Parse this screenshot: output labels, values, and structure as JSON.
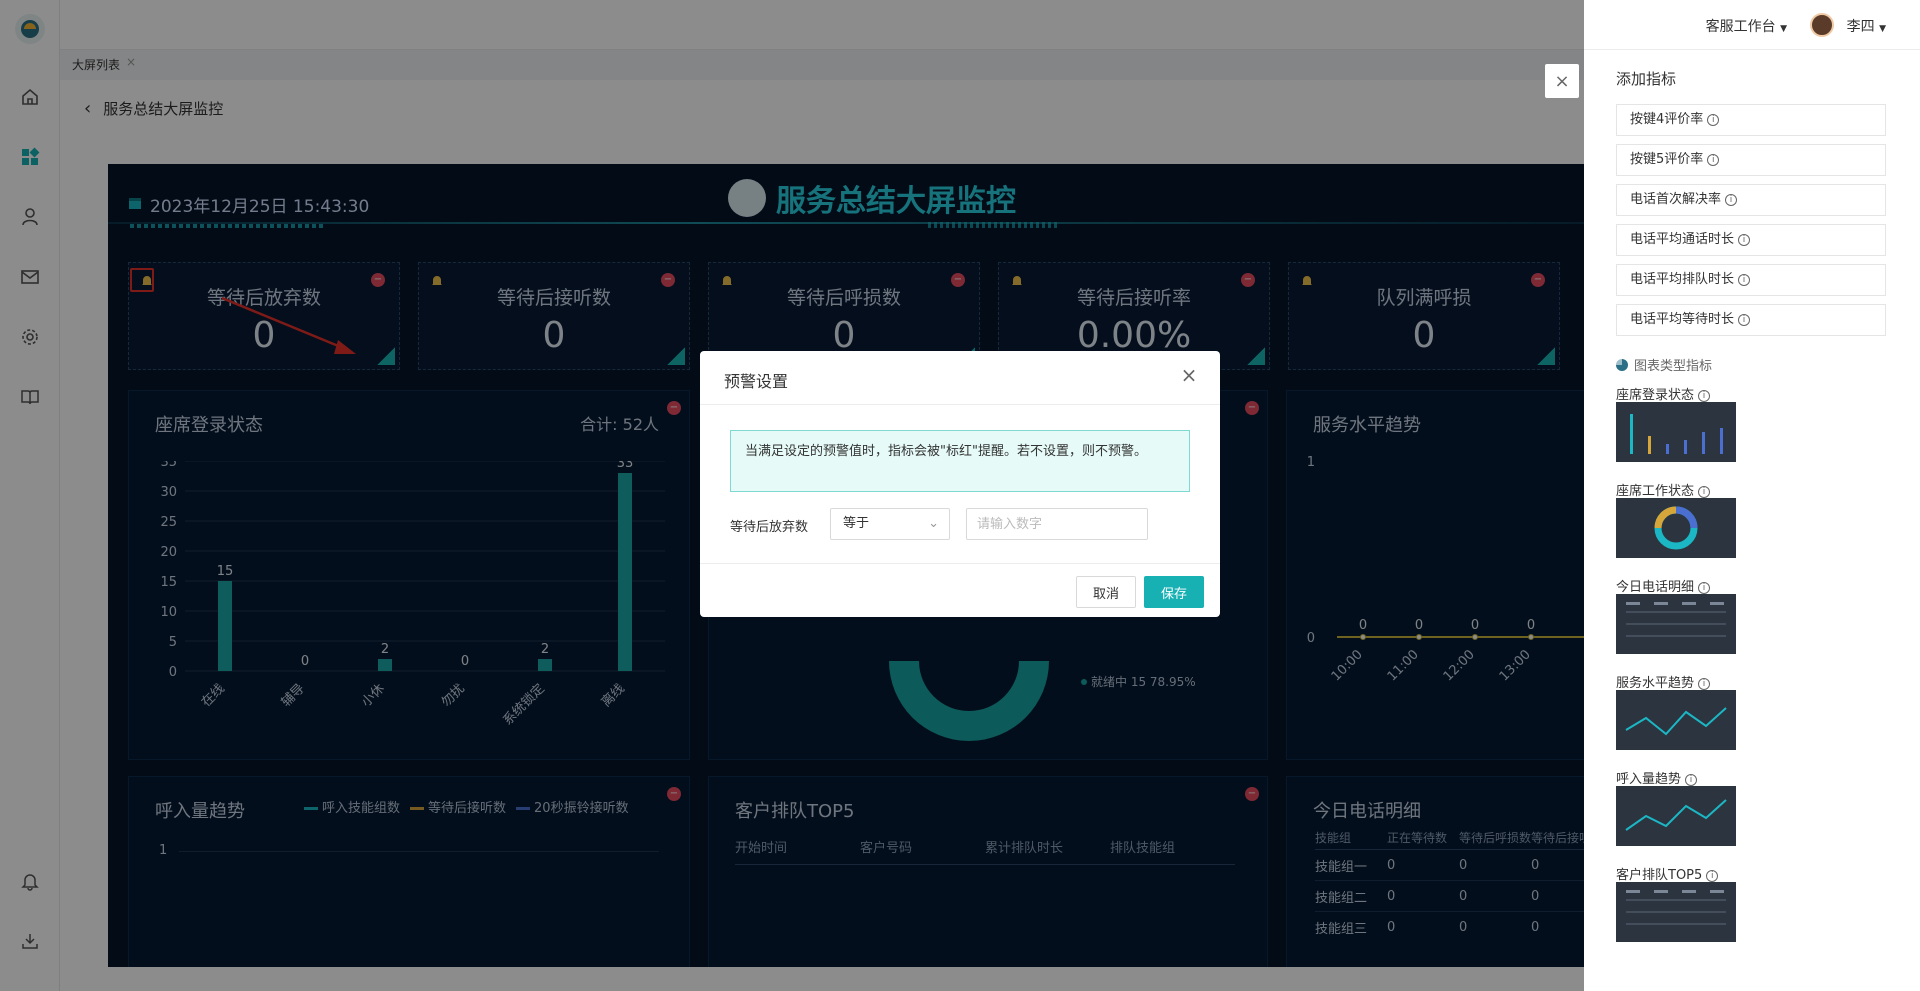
{
  "topbar": {
    "workspace": "客服工作台",
    "user": "李四"
  },
  "tabs": [
    {
      "label": "大屏列表"
    }
  ],
  "page": {
    "title": "服务总结大屏监控"
  },
  "screen": {
    "title": "服务总结大屏监控",
    "datetime": "2023年12月25日 15:43:30",
    "kpis": [
      {
        "label": "等待后放弃数",
        "value": "0"
      },
      {
        "label": "等待后接听数",
        "value": "0"
      },
      {
        "label": "等待后呼损数",
        "value": "0"
      },
      {
        "label": "等待后接听率",
        "value": "0.00%"
      },
      {
        "label": "队列满呼损",
        "value": "0"
      }
    ],
    "seat_panel": {
      "title": "座席登录状态",
      "total": "合计: 52人"
    },
    "service_panel": {
      "title": "服务水平趋势"
    },
    "calls_panel": {
      "title": "呼入量趋势",
      "legend": [
        "呼入技能组数",
        "等待后接听数",
        "20秒振铃接听数"
      ],
      "y_tick": "1"
    },
    "queue_panel": {
      "title": "客户排队TOP5",
      "headers": [
        "开始时间",
        "客户号码",
        "累计排队时长",
        "排队技能组"
      ]
    },
    "detail_panel": {
      "title": "今日电话明细",
      "headers": [
        "技能组",
        "正在等待数",
        "等待后呼损数",
        "等待后接听数"
      ],
      "rows": [
        [
          "技能组一",
          "0",
          "0",
          "0"
        ],
        [
          "技能组二",
          "0",
          "0",
          "0"
        ],
        [
          "技能组三",
          "0",
          "0",
          "0"
        ]
      ]
    },
    "donut_label": "就绪中  15  78.95%"
  },
  "chart_data": [
    {
      "type": "bar",
      "title": "座席登录状态",
      "categories": [
        "在线",
        "辅导",
        "小休",
        "勿扰",
        "系统锁定",
        "离线"
      ],
      "values": [
        15,
        0,
        2,
        0,
        2,
        33
      ],
      "yticks": [
        0,
        5,
        10,
        15,
        20,
        25,
        30,
        35
      ],
      "ylim": [
        0,
        35
      ],
      "color": "#1aa8a6"
    },
    {
      "type": "line",
      "title": "服务水平趋势",
      "x": [
        "10:00",
        "11:00",
        "12:00",
        "13:00"
      ],
      "values": [
        0,
        0,
        0,
        0
      ],
      "yticks": [
        0,
        1
      ],
      "color": "#c6b53a"
    }
  ],
  "drawer": {
    "title": "添加指标",
    "metrics": [
      "按键4评价率",
      "按键5评价率",
      "电话首次解决率",
      "电话平均通话时长",
      "电话平均排队时长",
      "电话平均等待时长"
    ],
    "section": "图表类型指标",
    "charts": [
      "座席登录状态",
      "座席工作状态",
      "今日电话明细",
      "服务水平趋势",
      "呼入量趋势",
      "客户排队TOP5"
    ]
  },
  "modal": {
    "title": "预警设置",
    "tip": "当满足设定的预警值时，指标会被\"标红\"提醒。若不设置，则不预警。",
    "field_label": "等待后放弃数",
    "operator": "等于",
    "placeholder": "请输入数字",
    "cancel": "取消",
    "save": "保存"
  },
  "colors": {
    "accent": "#17b1b4",
    "screen_bg": "#06152b",
    "alert_red": "#e54c5e",
    "annotation": "#e8322b"
  }
}
